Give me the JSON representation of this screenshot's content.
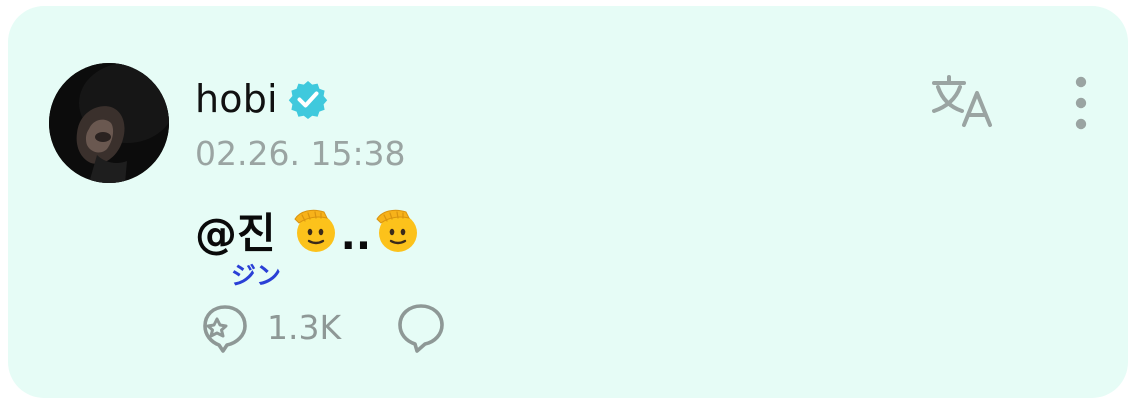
{
  "post": {
    "author": {
      "name": "hobi",
      "verified": true,
      "avatar_icon": "profile-photo"
    },
    "timestamp": "02.26. 15:38",
    "message": {
      "mention": "@진",
      "emoji": "saluting-face",
      "separator": "..",
      "furigana": "ジン"
    },
    "likes": "1.3K",
    "icons": {
      "verified": "verified-badge-icon",
      "translate": "translate-icon",
      "more": "more-vertical-icon",
      "like": "like-icon",
      "comment": "comment-icon"
    }
  },
  "colors": {
    "card_background": "#e6fcf6",
    "verified_badge": "#3fc9dd",
    "meta_text": "#9aa4a2",
    "furigana": "#2a3fd6",
    "icon_gray": "#8e9896"
  }
}
